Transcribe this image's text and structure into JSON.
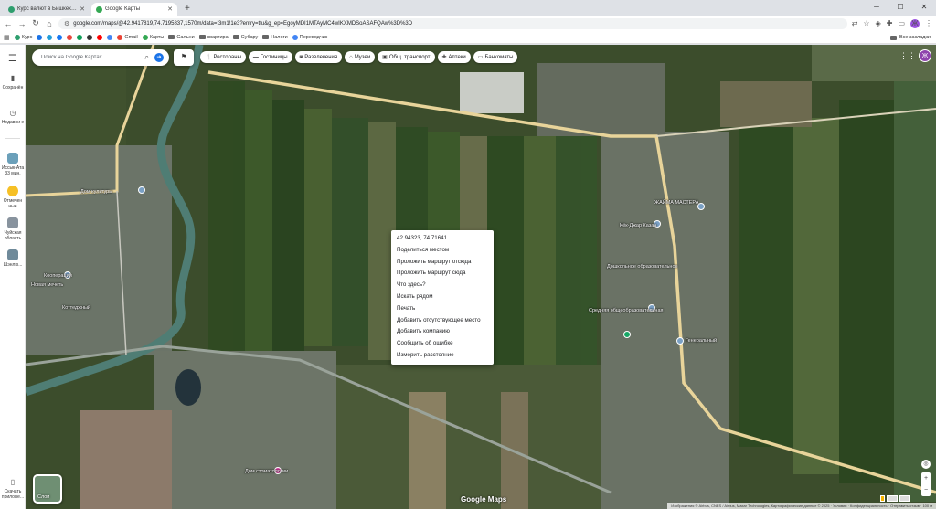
{
  "tabs": [
    {
      "title": "Курс валют в Бишкеке. Обмен",
      "favicon_color": "#2e9e6e",
      "active": false
    },
    {
      "title": "Google Карты",
      "favicon_color": "#34a853",
      "active": true
    }
  ],
  "address": {
    "url": "google.com/maps/@42.9417819,74.7195837,1570m/data=!3m1!1e3?entry=ttu&g_ep=EgoyMDI1MTAyMC4wIKXMDSoASAFQAw%3D%3D"
  },
  "bookmarks": {
    "items": [
      {
        "label": "Курс",
        "color": "#2e9e6e",
        "kind": "site"
      },
      {
        "label": "",
        "color": "#1a73e8",
        "kind": "site"
      },
      {
        "label": "",
        "color": "#229ed9",
        "kind": "site"
      },
      {
        "label": "",
        "color": "#1877f2",
        "kind": "site"
      },
      {
        "label": "",
        "color": "#e8453c",
        "kind": "site"
      },
      {
        "label": "",
        "color": "#0f9d58",
        "kind": "site"
      },
      {
        "label": "",
        "color": "#333333",
        "kind": "site"
      },
      {
        "label": "",
        "color": "#ff0000",
        "kind": "site"
      },
      {
        "label": "",
        "color": "#4285f4",
        "kind": "site"
      },
      {
        "label": "Gmail",
        "color": "#ea4335",
        "kind": "site"
      },
      {
        "label": "Карты",
        "color": "#34a853",
        "kind": "site"
      },
      {
        "label": "Сальни",
        "color": "#666666",
        "kind": "folder"
      },
      {
        "label": "квартира",
        "color": "#666666",
        "kind": "folder"
      },
      {
        "label": "Субару",
        "color": "#666666",
        "kind": "folder"
      },
      {
        "label": "Налоги",
        "color": "#666666",
        "kind": "folder"
      },
      {
        "label": "Переводчик",
        "color": "#4285f4",
        "kind": "site"
      }
    ],
    "all_label": "Все закладки"
  },
  "rail": {
    "saved": "Сохранён",
    "recent": "Недавни е",
    "places": [
      {
        "label": "Иссык-Ата 33 мин.",
        "color": "#6ba0ba"
      },
      {
        "label": "Отмечен ные",
        "color": "#f6c026"
      },
      {
        "label": "Чуйская область",
        "color": "#88939e"
      },
      {
        "label": "Шэнлю...",
        "color": "#6f8a9a"
      }
    ],
    "download": "Скачать приложе..."
  },
  "search": {
    "placeholder": "Поиск на Google Картах"
  },
  "chips": [
    {
      "label": "Рестораны",
      "icon": "fork-knife-icon"
    },
    {
      "label": "Гостиницы",
      "icon": "bed-icon"
    },
    {
      "label": "Развлечения",
      "icon": "camera-icon"
    },
    {
      "label": "Музеи",
      "icon": "museum-icon"
    },
    {
      "label": "Общ. транспорт",
      "icon": "bus-icon"
    },
    {
      "label": "Аптеки",
      "icon": "pill-icon"
    },
    {
      "label": "Банкоматы",
      "icon": "atm-icon"
    }
  ],
  "account_initial": "Ж",
  "context_menu": {
    "coords": "42.94323, 74.71641",
    "items": [
      "Поделиться местом",
      "Проложить маршрут отсюда",
      "Проложить маршрут сюда",
      "Что здесь?",
      "Искать рядом",
      "Печать",
      "Добавить отсутствующее место",
      "Добавить компанию",
      "Сообщить об ошибке",
      "Измерить расстояние"
    ]
  },
  "map_labels": [
    "Кёк-Джар Казан",
    "Дошкольное образовательное",
    "Средняя общеобразовательная",
    "Генеральный",
    "ЖАЙМА МАСТЕРА",
    "Дом культуры",
    "Кооперации",
    "Новая мечеть",
    "Коттеджный",
    "Дом стоматологии"
  ],
  "layers_label": "Слои",
  "logo": "Google Maps",
  "attribution": "Изображения © Airbus, CNES / Airbus, Maxar Technologies, Картографические данные © 2025 · Условия · Конфиденциальность · Отправить отзыв · 100 м"
}
